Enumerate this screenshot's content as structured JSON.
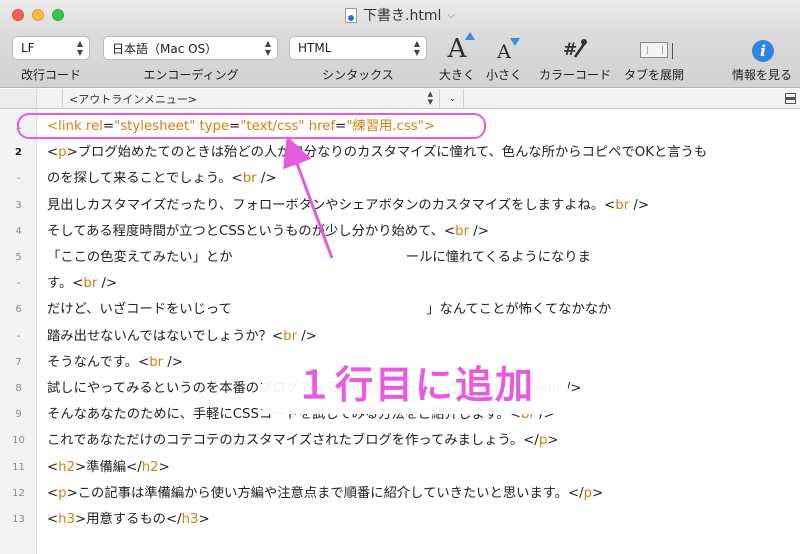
{
  "window": {
    "title": "下書き.html"
  },
  "toolbar": {
    "line_ending": {
      "value": "LF",
      "label": "改行コード"
    },
    "encoding": {
      "value": "日本語（Mac OS）",
      "label": "エンコーディング"
    },
    "syntax": {
      "value": "HTML",
      "label": "シンタックス"
    },
    "bigger": {
      "label": "大きく"
    },
    "smaller": {
      "label": "小さく"
    },
    "color_code": {
      "label": "カラーコード"
    },
    "expand_tabs": {
      "label": "タブを展開"
    },
    "info": {
      "label": "情報を見る"
    }
  },
  "outline": {
    "menu": "<アウトラインメニュー>"
  },
  "editor": {
    "lines": [
      {
        "num": "1",
        "segments": [
          [
            "<",
            "t"
          ],
          [
            "link",
            "t"
          ],
          [
            " ",
            "p"
          ],
          [
            "rel",
            "a"
          ],
          [
            "=",
            "p"
          ],
          [
            "\"stylesheet\"",
            "s"
          ],
          [
            " ",
            "p"
          ],
          [
            "type",
            "a"
          ],
          [
            "=",
            "p"
          ],
          [
            "\"text/css\"",
            "s"
          ],
          [
            " ",
            "p"
          ],
          [
            "href",
            "a"
          ],
          [
            "=",
            "p"
          ],
          [
            "\"練習用.css\"",
            "s"
          ],
          [
            ">",
            "t"
          ]
        ]
      },
      {
        "num": "2",
        "segments": [
          [
            "<",
            "p"
          ],
          [
            "p",
            "t"
          ],
          [
            ">ブログ始めたてのときは殆どの人が自分なりのカスタマイズに憧れて、色んな所からコピペでOKと言うも",
            "p"
          ]
        ]
      },
      {
        "num": "-",
        "segments": [
          [
            "のを探して来ることでしょう。<",
            "p"
          ],
          [
            "br",
            "t"
          ],
          [
            " />",
            "p"
          ]
        ]
      },
      {
        "num": "3",
        "segments": [
          [
            "見出しカスタマイズだったり、フォローボタンやシェアボタンのカスタマイズをしますよね。<",
            "p"
          ],
          [
            "br",
            "t"
          ],
          [
            " />",
            "p"
          ]
        ]
      },
      {
        "num": "4",
        "segments": [
          [
            "そしてある程度時間が立つとCSSというものが少し分かり始めて、<",
            "p"
          ],
          [
            "br",
            "t"
          ],
          [
            " />",
            "p"
          ]
        ]
      },
      {
        "num": "5",
        "segments": [
          [
            "「ここの色変えてみたい」とか",
            "p"
          ],
          [
            "                                         ",
            "p"
          ],
          [
            "ールに憧れてくるようになりま",
            "p"
          ]
        ]
      },
      {
        "num": "-",
        "segments": [
          [
            "す。<",
            "p"
          ],
          [
            "br",
            "t"
          ],
          [
            " />",
            "p"
          ]
        ]
      },
      {
        "num": "6",
        "segments": [
          [
            "だけど、いざコードをいじって",
            "p"
          ],
          [
            "                                              ",
            "p"
          ],
          [
            "」なんてことが怖くてなかなか",
            "p"
          ]
        ]
      },
      {
        "num": "-",
        "segments": [
          [
            "踏み出せないんではないでしょうか？<",
            "p"
          ],
          [
            "br",
            "t"
          ],
          [
            " />",
            "p"
          ]
        ]
      },
      {
        "num": "7",
        "segments": [
          [
            "そうなんです。<",
            "p"
          ],
          [
            "br",
            "t"
          ],
          [
            " />",
            "p"
          ]
        ]
      },
      {
        "num": "8",
        "segments": [
          [
            "試しにやってみるというのを本番のブログでやるのは何かあったときが怖いです。<",
            "p"
          ],
          [
            "br",
            "t"
          ],
          [
            " />",
            "p"
          ]
        ]
      },
      {
        "num": "9",
        "segments": [
          [
            "そんなあなたのために、手軽にCSSコードを試してみる方法をご紹介します。<",
            "p"
          ],
          [
            "br",
            "t"
          ],
          [
            " />",
            "p"
          ]
        ]
      },
      {
        "num": "10",
        "segments": [
          [
            "これであなただけのコテコテのカスタマイズされたブログを作ってみましょう。</",
            "p"
          ],
          [
            "p",
            "t"
          ],
          [
            ">",
            "p"
          ]
        ]
      },
      {
        "num": "11",
        "segments": [
          [
            "<",
            "p"
          ],
          [
            "h2",
            "t"
          ],
          [
            ">準備編</",
            "p"
          ],
          [
            "h2",
            "t"
          ],
          [
            ">",
            "p"
          ]
        ]
      },
      {
        "num": "12",
        "segments": [
          [
            "<",
            "p"
          ],
          [
            "p",
            "t"
          ],
          [
            ">この記事は準備編から使い方編や注意点まで順番に紹介していきたいと思います。</",
            "p"
          ],
          [
            "p",
            "t"
          ],
          [
            ">",
            "p"
          ]
        ]
      },
      {
        "num": "13",
        "segments": [
          [
            "<",
            "p"
          ],
          [
            "h3",
            "t"
          ],
          [
            ">用意するもの</",
            "p"
          ],
          [
            "h3",
            "t"
          ],
          [
            ">",
            "p"
          ]
        ]
      }
    ],
    "current_line": "2"
  },
  "annotation": {
    "text": "１行目に追加",
    "color": "#e85ae0"
  },
  "colors": {
    "accent": "#e85ae0",
    "tag": "#e07b10",
    "info": "#2f86e0"
  }
}
